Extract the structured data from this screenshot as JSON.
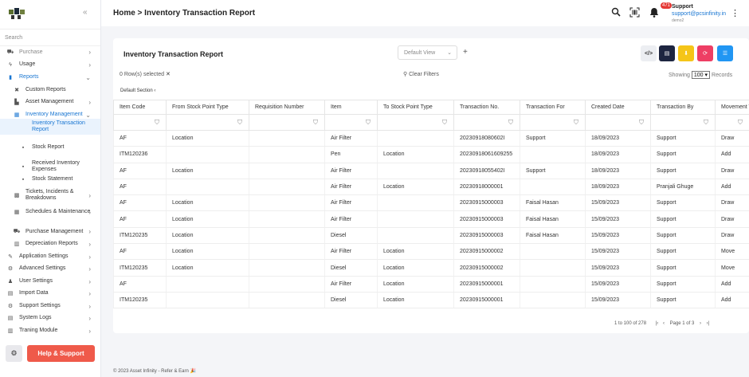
{
  "sidebar": {
    "search_placeholder": "Search",
    "items": [
      {
        "label": "Purchase",
        "icon": "cart-icon"
      },
      {
        "label": "Usage",
        "icon": "bolt-icon"
      },
      {
        "label": "Reports",
        "icon": "report-icon"
      },
      {
        "label": "Custom Reports",
        "icon": "tools-icon"
      },
      {
        "label": "Asset Management",
        "icon": "building-icon"
      },
      {
        "label": "Inventory Management",
        "icon": "inventory-icon"
      },
      {
        "label": "Inventory Transaction Report",
        "icon": ""
      },
      {
        "label": "Stock Report",
        "icon": "doc-icon"
      },
      {
        "label": "Received Inventory Expenses",
        "icon": "doc-icon"
      },
      {
        "label": "Stock Statement",
        "icon": "doc-icon"
      },
      {
        "label": "Tickets, Incidents & Breakdowns",
        "icon": "ticket-icon"
      },
      {
        "label": "Schedules & Maintenance",
        "icon": "calendar-icon"
      },
      {
        "label": "Purchase Management",
        "icon": "cart-icon"
      },
      {
        "label": "Depreciation Reports",
        "icon": "chart-icon"
      },
      {
        "label": "Application Settings",
        "icon": "wrench-icon"
      },
      {
        "label": "Advanced Settings",
        "icon": "gears-icon"
      },
      {
        "label": "User Settings",
        "icon": "users-icon"
      },
      {
        "label": "Import Data",
        "icon": "import-icon"
      },
      {
        "label": "Support Settings",
        "icon": "support-icon"
      },
      {
        "label": "System Logs",
        "icon": "logs-icon"
      },
      {
        "label": "Traning Module",
        "icon": "training-icon"
      }
    ],
    "help_label": "Help & Support"
  },
  "header": {
    "breadcrumb": "Home > Inventory Transaction Report",
    "notif_count": "471",
    "user_name": "Support",
    "user_email": "support@pcsinfinity.in",
    "user_role": "demo2"
  },
  "card": {
    "title": "Inventory Transaction Report",
    "view_select": "Default View",
    "rows_selected": "0 Row(s) selected",
    "clear_filters": "Clear Filters",
    "showing_label": "Showing",
    "showing_value": "100",
    "records_label": "Records",
    "section_label": "Default Section"
  },
  "table": {
    "columns": [
      "Item Code",
      "From Stock Point Type",
      "Requisition Number",
      "Item",
      "To Stock Point Type",
      "Transaction No.",
      "Transaction For",
      "Created Date",
      "Transaction By",
      "Movement T"
    ],
    "rows": [
      [
        "AF",
        "Location",
        "",
        "Air Filter",
        "",
        "20230918080602I",
        "Support",
        "18/09/2023",
        "Support",
        "Draw"
      ],
      [
        "ITM120236",
        "",
        "",
        "Pen",
        "Location",
        "20230918061609255",
        "",
        "18/09/2023",
        "Support",
        "Add"
      ],
      [
        "AF",
        "Location",
        "",
        "Air Filter",
        "",
        "20230918055402I",
        "Support",
        "18/09/2023",
        "Support",
        "Draw"
      ],
      [
        "AF",
        "",
        "",
        "Air Filter",
        "Location",
        "20230918000001",
        "",
        "18/09/2023",
        "Pranjali Ghuge",
        "Add"
      ],
      [
        "AF",
        "Location",
        "",
        "Air Filter",
        "",
        "20230915000003",
        "Faisal Hasan",
        "15/09/2023",
        "Support",
        "Draw"
      ],
      [
        "AF",
        "Location",
        "",
        "Air Filter",
        "",
        "20230915000003",
        "Faisal Hasan",
        "15/09/2023",
        "Support",
        "Draw"
      ],
      [
        "ITM120235",
        "Location",
        "",
        "Diesel",
        "",
        "20230915000003",
        "Faisal Hasan",
        "15/09/2023",
        "Support",
        "Draw"
      ],
      [
        "AF",
        "Location",
        "",
        "Air Filter",
        "Location",
        "20230915000002",
        "",
        "15/09/2023",
        "Support",
        "Move"
      ],
      [
        "ITM120235",
        "Location",
        "",
        "Diesel",
        "Location",
        "20230915000002",
        "",
        "15/09/2023",
        "Support",
        "Move"
      ],
      [
        "AF",
        "",
        "",
        "Air Filter",
        "Location",
        "20230915000001",
        "",
        "15/09/2023",
        "Support",
        "Add"
      ],
      [
        "ITM120235",
        "",
        "",
        "Diesel",
        "Location",
        "20230915000001",
        "",
        "15/09/2023",
        "Support",
        "Add"
      ]
    ]
  },
  "pager": {
    "range": "1 to 100 of 278",
    "page": "Page 1 of 3"
  },
  "footer": "© 2023  Asset Infinity - Refer & Earn 🎉"
}
